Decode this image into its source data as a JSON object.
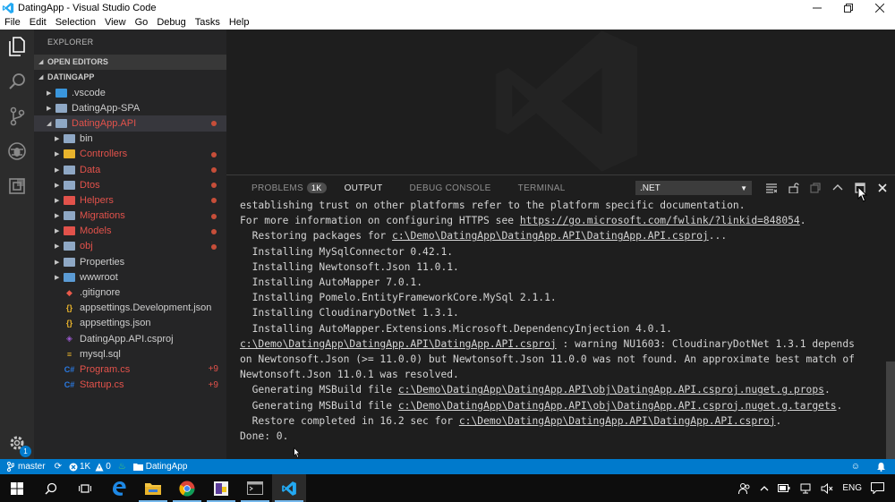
{
  "window": {
    "title": "DatingApp - Visual Studio Code"
  },
  "menu": [
    "File",
    "Edit",
    "Selection",
    "View",
    "Go",
    "Debug",
    "Tasks",
    "Help"
  ],
  "sidebar": {
    "title": "EXPLORER",
    "open_editors": "OPEN EDITORS",
    "project": "DATINGAPP",
    "tree": [
      {
        "label": ".vscode",
        "kind": "folder-special",
        "indent": 1,
        "caret": "▶"
      },
      {
        "label": "DatingApp-SPA",
        "kind": "folder",
        "indent": 1,
        "caret": "▶"
      },
      {
        "label": "DatingApp.API",
        "kind": "folder-open",
        "indent": 1,
        "caret": "◢",
        "red": true,
        "selected": true,
        "dot": true
      },
      {
        "label": "bin",
        "kind": "folder",
        "indent": 2,
        "caret": "▶"
      },
      {
        "label": "Controllers",
        "kind": "folder-yellow",
        "indent": 2,
        "caret": "▶",
        "red": true,
        "dot": true
      },
      {
        "label": "Data",
        "kind": "folder",
        "indent": 2,
        "caret": "▶",
        "red": true,
        "dot": true
      },
      {
        "label": "Dtos",
        "kind": "folder",
        "indent": 2,
        "caret": "▶",
        "red": true,
        "dot": true
      },
      {
        "label": "Helpers",
        "kind": "folder-red",
        "indent": 2,
        "caret": "▶",
        "red": true,
        "dot": true
      },
      {
        "label": "Migrations",
        "kind": "folder",
        "indent": 2,
        "caret": "▶",
        "red": true,
        "dot": true
      },
      {
        "label": "Models",
        "kind": "folder-red",
        "indent": 2,
        "caret": "▶",
        "red": true,
        "dot": true
      },
      {
        "label": "obj",
        "kind": "folder",
        "indent": 2,
        "caret": "▶",
        "red": true,
        "dot": true
      },
      {
        "label": "Properties",
        "kind": "folder",
        "indent": 2,
        "caret": "▶"
      },
      {
        "label": "wwwroot",
        "kind": "folder-blue",
        "indent": 2,
        "caret": "▶"
      },
      {
        "label": ".gitignore",
        "kind": "git",
        "indent": 2
      },
      {
        "label": "appsettings.Development.json",
        "kind": "json",
        "indent": 2
      },
      {
        "label": "appsettings.json",
        "kind": "json",
        "indent": 2
      },
      {
        "label": "DatingApp.API.csproj",
        "kind": "csproj",
        "indent": 2
      },
      {
        "label": "mysql.sql",
        "kind": "sql",
        "indent": 2
      },
      {
        "label": "Program.cs",
        "kind": "cs",
        "indent": 2,
        "red": true,
        "badge": "+9"
      },
      {
        "label": "Startup.cs",
        "kind": "cs",
        "indent": 2,
        "red": true,
        "badge": "+9"
      }
    ]
  },
  "panel": {
    "tabs": [
      {
        "label": "PROBLEMS",
        "count": "1K"
      },
      {
        "label": "OUTPUT",
        "active": true
      },
      {
        "label": "DEBUG CONSOLE"
      },
      {
        "label": "TERMINAL"
      }
    ],
    "output_channel": ".NET",
    "lines": [
      {
        "text": "establishing trust on other platforms refer to the platform specific documentation."
      },
      {
        "text": "For more information on configuring HTTPS see ",
        "link": "https://go.microsoft.com/fwlink/?linkid=848054",
        "after": "."
      },
      {
        "text": "  Restoring packages for ",
        "link": "c:\\Demo\\DatingApp\\DatingApp.API\\DatingApp.API.csproj",
        "after": "..."
      },
      {
        "text": "  Installing MySqlConnector 0.42.1."
      },
      {
        "text": "  Installing Newtonsoft.Json 11.0.1."
      },
      {
        "text": "  Installing AutoMapper 7.0.1."
      },
      {
        "text": "  Installing Pomelo.EntityFrameworkCore.MySql 2.1.1."
      },
      {
        "text": "  Installing CloudinaryDotNet 1.3.1."
      },
      {
        "text": "  Installing AutoMapper.Extensions.Microsoft.DependencyInjection 4.0.1."
      },
      {
        "text": "",
        "link": "c:\\Demo\\DatingApp\\DatingApp.API\\DatingApp.API.csproj",
        "after": " : warning NU1603: CloudinaryDotNet 1.3.1 depends"
      },
      {
        "text": "on Newtonsoft.Json (>= 11.0.0) but Newtonsoft.Json 11.0.0 was not found. An approximate best match of"
      },
      {
        "text": "Newtonsoft.Json 11.0.1 was resolved."
      },
      {
        "text": "  Generating MSBuild file ",
        "link": "c:\\Demo\\DatingApp\\DatingApp.API\\obj\\DatingApp.API.csproj.nuget.g.props",
        "after": "."
      },
      {
        "text": "  Generating MSBuild file ",
        "link": "c:\\Demo\\DatingApp\\DatingApp.API\\obj\\DatingApp.API.csproj.nuget.g.targets",
        "after": "."
      },
      {
        "text": "  Restore completed in 16.2 sec for ",
        "link": "c:\\Demo\\DatingApp\\DatingApp.API\\DatingApp.API.csproj",
        "after": "."
      },
      {
        "text": "Done: 0."
      }
    ]
  },
  "status": {
    "branch": "master",
    "errors": "1K",
    "warnings": "0",
    "folder": "DatingApp",
    "settings_badge": "1"
  },
  "tray": {
    "language": "ENG"
  },
  "colors": {
    "accent": "#007acc",
    "error": "#e2524b",
    "vscode_blue": "#23a9f2"
  }
}
